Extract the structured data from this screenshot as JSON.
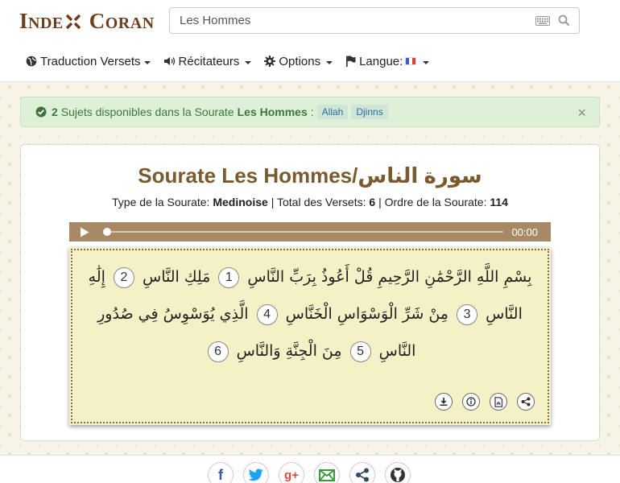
{
  "logo": {
    "part1_initial": "I",
    "part1_rest": "NDE",
    "part2_initial": "C",
    "part2_rest": "ORAN"
  },
  "search": {
    "value": "Les Hommes",
    "placeholder": ""
  },
  "nav": {
    "translation": "Traduction Versets",
    "reciters": "Récitateurs",
    "options": "Options",
    "language": "Langue:"
  },
  "alert": {
    "count": "2",
    "text": "Sujets disponibles dans la Sourate",
    "sura_name": "Les Hommes",
    "sep": ":",
    "tags": [
      "Allah",
      "Djinns"
    ],
    "close": "×"
  },
  "sura": {
    "title": "Sourate Les Hommes/سورة الناس",
    "type_label": "Type de la Sourate:",
    "type_value": "Medinoise",
    "verses_label": "Total des Versets:",
    "verses_value": "6",
    "order_label": "Ordre de la Sourate:",
    "order_value": "114",
    "sep": "|"
  },
  "player": {
    "time": "00:00",
    "progress": 0
  },
  "verses": {
    "basmala": "بِسْمِ اللَّهِ الرَّحْمَٰنِ الرَّحِيمِ",
    "items": [
      {
        "text": "قُلْ أَعُوذُ بِرَبِّ النَّاسِ",
        "num": "1"
      },
      {
        "text": "مَلِكِ النَّاسِ",
        "num": "2"
      },
      {
        "text": "إِلَٰهِ النَّاسِ",
        "num": "3"
      },
      {
        "text": "مِنْ شَرِّ الْوَسْوَاسِ الْخَنَّاسِ",
        "num": "4"
      },
      {
        "text": "الَّذِي يُوَسْوِسُ فِي صُدُورِ النَّاسِ",
        "num": "5"
      },
      {
        "text": "مِنَ الْجِنَّةِ وَالنَّاسِ",
        "num": "6"
      }
    ]
  },
  "colors": {
    "brand": "#6b3f1c",
    "title": "#7a5a2e",
    "player": "#a88966",
    "alert_bg": "#dff0d8"
  },
  "footer": {
    "icons": [
      "facebook-icon",
      "twitter-icon",
      "google-plus-icon",
      "email-icon",
      "share-icon",
      "github-icon"
    ],
    "labels": {
      "facebook": "f",
      "google": "g+"
    }
  }
}
